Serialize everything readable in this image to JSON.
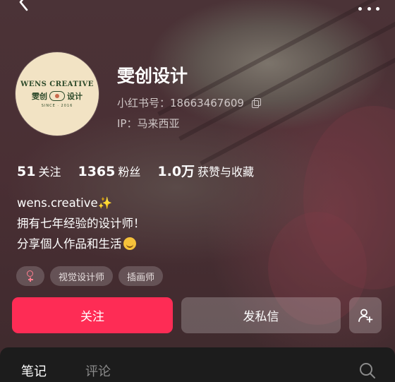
{
  "profile": {
    "name": "雯创设计",
    "avatar_line1": "WENS CREATIVE",
    "avatar_line2_left": "雯创",
    "avatar_line2_right": "设计",
    "avatar_line3": "SINCE · 2016",
    "redbook_id": "小红书号：18663467609",
    "ip": "IP：马来西亚"
  },
  "stats": [
    {
      "num": "51",
      "label": "关注"
    },
    {
      "num": "1365",
      "label": "粉丝"
    },
    {
      "num": "1.0万",
      "label": "获赞与收藏"
    }
  ],
  "bio": {
    "line1": "wens.creative",
    "line1_emoji": "✨",
    "line2": "拥有七年经验的设计师！",
    "line3": "分享個人作品和生活"
  },
  "tags": [
    "视觉设计师",
    "插画师"
  ],
  "buttons": {
    "follow": "关注",
    "message": "发私信"
  },
  "tabs": {
    "notes": "笔记",
    "comments": "评论"
  },
  "icons": {
    "back": "chevron-left-icon",
    "more": "more-dots-icon",
    "copy": "copy-icon",
    "gender": "female-icon",
    "add_user": "add-user-icon",
    "search": "search-icon"
  },
  "colors": {
    "follow_button": "#fe2c55",
    "gender_icon": "#ff7e8f",
    "tab_bar": "#1c1c1c"
  }
}
